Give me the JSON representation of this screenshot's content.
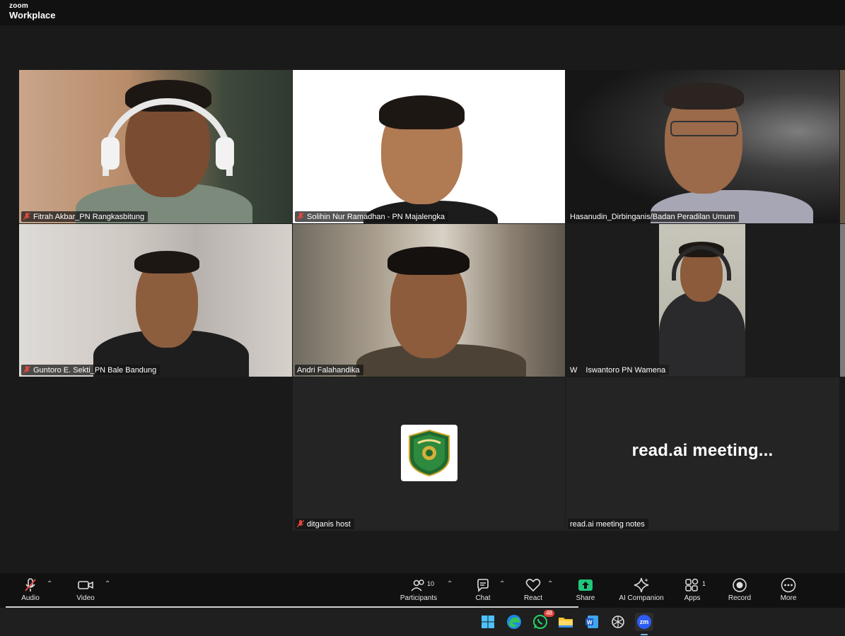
{
  "app": {
    "brand_top": "zoom",
    "brand_bottom": "Workplace"
  },
  "participants": [
    {
      "name": "Fitrah Akbar_PN Rangkasbitung",
      "muted": true
    },
    {
      "name": "Solihin Nur Ramadhan - PN Majalengka",
      "muted": true
    },
    {
      "name": "Hasanudin_Dirbinganis/Badan Peradilan Umum",
      "muted": false,
      "active_speaker": true
    },
    {
      "name": "Guntoro E. Sekti_PN Bale Bandung",
      "muted": true
    },
    {
      "name": "Andri Falahandika",
      "muted": false
    },
    {
      "name": "Iswantoro PN Wamena",
      "prefix": "W",
      "muted": false
    },
    {
      "name": "ditganis host",
      "muted": true
    },
    {
      "name": "read.ai meeting notes",
      "muted": false,
      "display_text": "read.ai  meeting..."
    }
  ],
  "toolbar": {
    "audio_label": "Audio",
    "video_label": "Video",
    "participants_label": "Participants",
    "participants_count": "10",
    "chat_label": "Chat",
    "react_label": "React",
    "share_label": "Share",
    "ai_label": "AI Companion",
    "apps_label": "Apps",
    "apps_count": "1",
    "record_label": "Record",
    "more_label": "More",
    "share_color": "#21c77a"
  },
  "taskbar": {
    "whatsapp_badge": "48",
    "zoom_icon_text": "zm"
  },
  "colors": {
    "active_outline": "#3ecf8e",
    "muted_icon": "#e3483e"
  }
}
